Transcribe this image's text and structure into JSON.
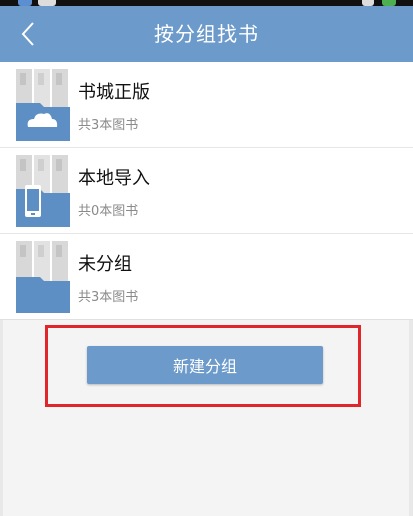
{
  "header": {
    "title": "按分组找书"
  },
  "groups": [
    {
      "name": "书城正版",
      "count": "共3本图书",
      "icon": "cloud-folder-icon"
    },
    {
      "name": "本地导入",
      "count": "共0本图书",
      "icon": "phone-folder-icon"
    },
    {
      "name": "未分组",
      "count": "共3本图书",
      "icon": "folder-icon"
    }
  ],
  "actions": {
    "new_group_label": "新建分组"
  },
  "colors": {
    "accent": "#6c9acb",
    "highlight": "#e0262b"
  }
}
